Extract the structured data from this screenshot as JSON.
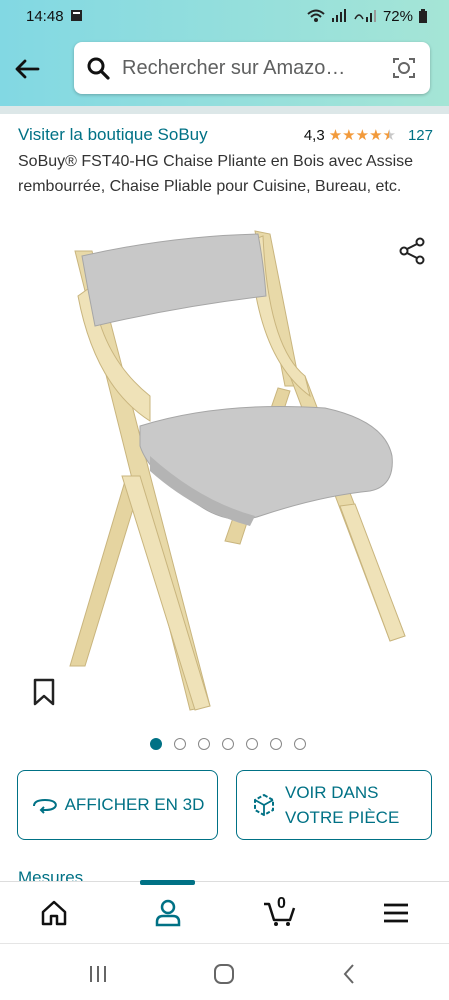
{
  "status_bar": {
    "time": "14:48",
    "battery": "72%"
  },
  "search": {
    "placeholder": "Rechercher sur Amazo…"
  },
  "product": {
    "store_link": "Visiter la boutique SoBuy",
    "rating_value": "4,3",
    "rating_stars": 4.3,
    "review_count": "127",
    "title": "SoBuy® FST40-HG Chaise Pliante en Bois avec Assise rembourrée, Chaise Pliable pour Cuisine, Bureau, etc."
  },
  "carousel": {
    "total": 7,
    "active_index": 0
  },
  "buttons": {
    "view_3d": "AFFICHER EN 3D",
    "view_room_line1": "VOIR DANS",
    "view_room_line2": "VOTRE PIÈCE"
  },
  "section": {
    "measures": "Mesures"
  },
  "navbar": {
    "cart_count": "0",
    "active": "profile"
  },
  "colors": {
    "accent": "#007185",
    "star": "#f29a3b",
    "header_gradient_start": "#82d8e3",
    "header_gradient_end": "#a5e5d6"
  },
  "icons": [
    "back-arrow-icon",
    "search-icon",
    "camera-lens-icon",
    "share-icon",
    "bookmark-icon",
    "3d-rotate-icon",
    "ar-cube-icon",
    "home-icon",
    "profile-icon",
    "cart-icon",
    "menu-icon"
  ]
}
